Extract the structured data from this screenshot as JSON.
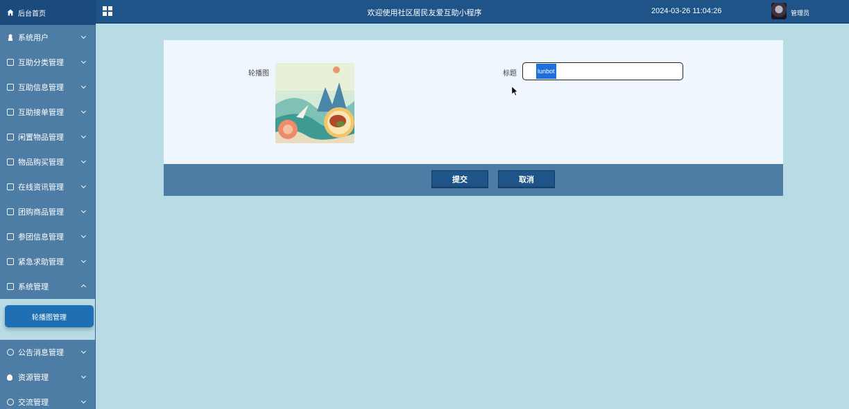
{
  "header": {
    "home_label": "后台首页",
    "title": "欢迎使用社区居民友爱互助小程序",
    "datetime": "2024-03-26 11:04:26",
    "user": "管理员"
  },
  "sidebar": {
    "items": [
      {
        "label": "系统用户",
        "icon": "user-icon"
      },
      {
        "label": "互助分类管理",
        "icon": "external-link-icon"
      },
      {
        "label": "互助信息管理",
        "icon": "external-link-icon"
      },
      {
        "label": "互助接单管理",
        "icon": "external-link-icon"
      },
      {
        "label": "闲置物品管理",
        "icon": "external-link-icon"
      },
      {
        "label": "物品购买管理",
        "icon": "external-link-icon"
      },
      {
        "label": "在线资讯管理",
        "icon": "external-link-icon"
      },
      {
        "label": "团购商品管理",
        "icon": "external-link-icon"
      },
      {
        "label": "参团信息管理",
        "icon": "external-link-icon"
      },
      {
        "label": "紧急求助管理",
        "icon": "external-link-icon"
      },
      {
        "label": "系统管理",
        "icon": "picture-icon"
      }
    ],
    "active_sub": "轮播图管理",
    "bottom_items": [
      {
        "label": "公告消息管理",
        "icon": "info-icon"
      },
      {
        "label": "资源管理",
        "icon": "bulb-icon"
      },
      {
        "label": "交流管理",
        "icon": "chat-icon"
      }
    ]
  },
  "form": {
    "image_label": "轮播图",
    "title_label": "标题",
    "title_value": "lunbot"
  },
  "actions": {
    "submit": "提交",
    "cancel": "取消"
  }
}
